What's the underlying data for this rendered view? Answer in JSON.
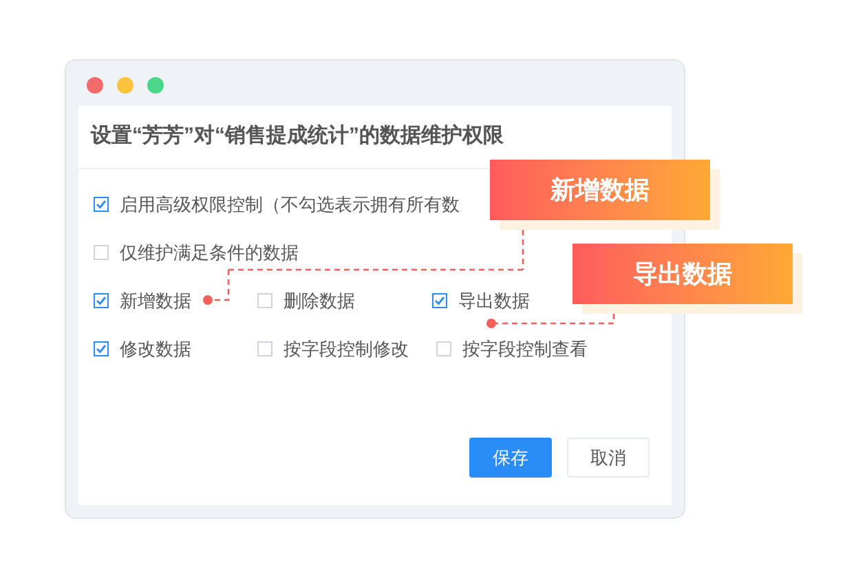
{
  "window": {
    "title": "设置“芳芳”对“销售提成统计”的数据维护权限"
  },
  "options": [
    [
      {
        "label": "启用高级权限控制（不勾选表示拥有所有数",
        "checked": true
      }
    ],
    [
      {
        "label": "仅维护满足条件的数据",
        "checked": false
      }
    ],
    [
      {
        "label": "新增数据",
        "checked": true
      },
      {
        "label": "删除数据",
        "checked": false
      },
      {
        "label": "导出数据",
        "checked": true
      }
    ],
    [
      {
        "label": "修改数据",
        "checked": true
      },
      {
        "label": "按字段控制修改",
        "checked": false
      },
      {
        "label": "按字段控制查看",
        "checked": false
      }
    ]
  ],
  "buttons": [
    {
      "label": "保存",
      "kind": "primary"
    },
    {
      "label": "取消",
      "kind": "secondary"
    }
  ],
  "callouts": [
    "新增数据",
    "导出数据"
  ]
}
